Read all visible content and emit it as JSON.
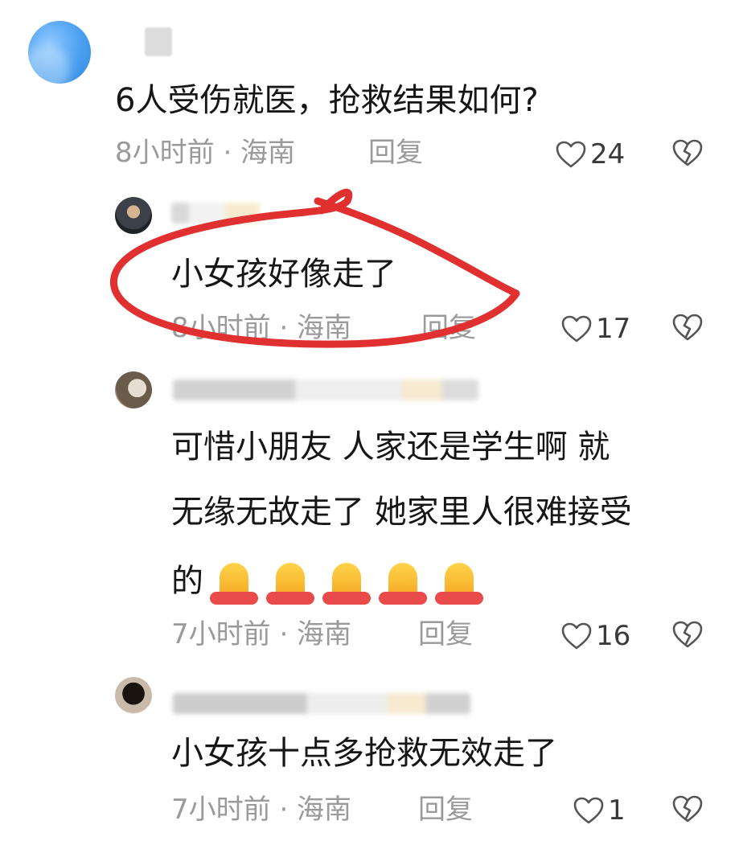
{
  "comments": [
    {
      "text": "6人受伤就医，抢救结果如何?",
      "time": "8小时前 · 海南",
      "reply": "回复",
      "likes": "24"
    },
    {
      "text": "小女孩好像走了",
      "time": "8小时前 · 海南",
      "reply": "回复",
      "likes": "17"
    },
    {
      "text_lines": [
        "可惜小朋友 人家还是学生啊 就",
        "无缘无故走了 她家里人很难接受",
        "的"
      ],
      "time": "7小时前 · 海南",
      "reply": "回复",
      "likes": "16"
    },
    {
      "text": "小女孩十点多抢救无效走了",
      "time": "7小时前 · 海南",
      "reply": "回复",
      "likes": "1"
    }
  ],
  "icons": {
    "like": "heart-outline-icon",
    "dislike": "broken-heart-icon",
    "emoji": "folded-hands-emoji"
  },
  "colors": {
    "text": "#161616",
    "meta": "#9a9a9a",
    "highlight_scribble": "#e0302f"
  }
}
